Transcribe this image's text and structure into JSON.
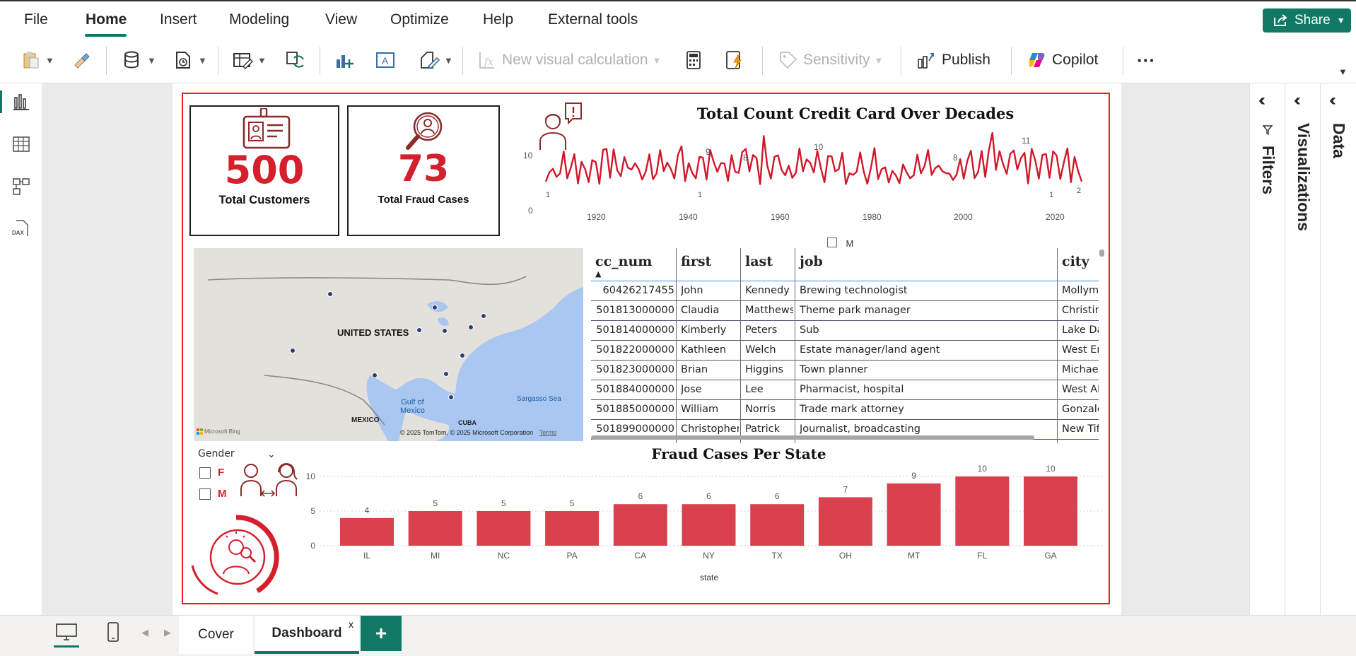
{
  "menu": {
    "items": [
      "File",
      "Home",
      "Insert",
      "Modeling",
      "View",
      "Optimize",
      "Help",
      "External tools"
    ],
    "active": "Home",
    "share_label": "Share"
  },
  "ribbon": {
    "new_visual_calc": "New visual calculation",
    "sensitivity": "Sensitivity",
    "publish": "Publish",
    "copilot": "Copilot",
    "more": "···"
  },
  "kpis": {
    "customers": {
      "value": "500",
      "label": "Total Customers"
    },
    "fraud": {
      "value": "73",
      "label": "Total Fraud Cases"
    }
  },
  "line_chart": {
    "title": "Total Count Credit Card Over Decades",
    "y_ticks": [
      "10",
      "0"
    ],
    "x_ticks": [
      "1920",
      "1940",
      "1960",
      "1980",
      "2000",
      "2020"
    ],
    "peak_labels": [
      "9",
      "8",
      "10",
      "8",
      "11",
      "1",
      "1",
      "2",
      "1"
    ],
    "legend_partial": "M"
  },
  "map": {
    "country_label": "UNITED STATES",
    "gulf_label": "Gulf of\nMexico",
    "sargasso_label": "Sargasso Sea",
    "mexico_label": "MEXICO",
    "cuba_label": "CUBA",
    "bing": "Microsoft Bing",
    "copyright": "© 2025 TomTom, © 2025 Microsoft Corporation",
    "terms": "Terms"
  },
  "table": {
    "headers": [
      "cc_num",
      "first",
      "last",
      "job",
      "city"
    ],
    "rows": [
      [
        "60426217455",
        "John",
        "Kennedy",
        "Brewing technologist",
        "Mollym"
      ],
      [
        "501813000000",
        "Claudia",
        "Matthews",
        "Theme park manager",
        "Christin"
      ],
      [
        "501814000000",
        "Kimberly",
        "Peters",
        "Sub",
        "Lake Da"
      ],
      [
        "501822000000",
        "Kathleen",
        "Welch",
        "Estate manager/land agent",
        "West Eri"
      ],
      [
        "501823000000",
        "Brian",
        "Higgins",
        "Town planner",
        "Michael"
      ],
      [
        "501884000000",
        "Jose",
        "Lee",
        "Pharmacist, hospital",
        "West Al"
      ],
      [
        "501885000000",
        "William",
        "Norris",
        "Trade mark attorney",
        "Gonzale"
      ],
      [
        "501899000000",
        "Christopher",
        "Patrick",
        "Journalist, broadcasting",
        "New Tif"
      ]
    ]
  },
  "slicer": {
    "title": "Gender",
    "options": [
      "F",
      "M"
    ]
  },
  "chart_data": {
    "type": "bar",
    "title": "Fraud Cases Per State",
    "categories": [
      "IL",
      "MI",
      "NC",
      "PA",
      "CA",
      "NY",
      "TX",
      "OH",
      "MT",
      "FL",
      "GA"
    ],
    "values": [
      4,
      5,
      5,
      5,
      6,
      6,
      6,
      7,
      9,
      10,
      10
    ],
    "xlabel": "state",
    "ylabel": "",
    "ylim": [
      0,
      10
    ],
    "y_ticks": [
      0,
      5,
      10
    ],
    "color": "#d9414f"
  },
  "right_panels": {
    "filters": "Filters",
    "visualizations": "Visualizations",
    "data": "Data"
  },
  "pages": {
    "tabs": [
      "Cover",
      "Dashboard"
    ],
    "active": "Dashboard",
    "close": "x",
    "add": "+"
  },
  "colors": {
    "accent": "#117865",
    "kpi_red": "#d41f2d",
    "frame_red": "#e01f26",
    "line_red": "#d0182a"
  }
}
